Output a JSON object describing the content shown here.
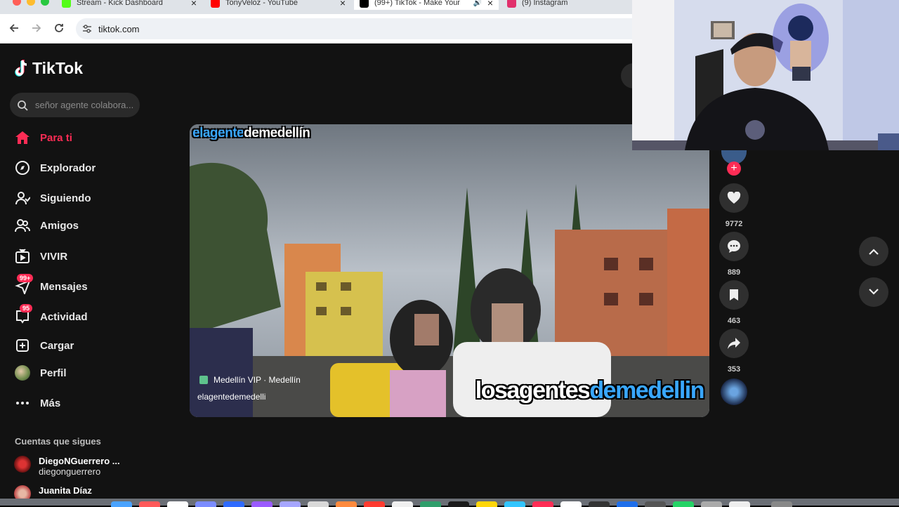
{
  "browser": {
    "tabs": [
      {
        "label": "Stream - Kick Dashboard",
        "icon": "kick-icon",
        "color": "#53fc18"
      },
      {
        "label": "TonyVeloz - YouTube",
        "icon": "youtube-icon",
        "color": "#ff0000"
      },
      {
        "label": "(99+) TikTok - Make Your",
        "icon": "tiktok-icon",
        "color": "#000000"
      },
      {
        "label": "(9) Instagram",
        "icon": "instagram-icon",
        "color": "#e1306c"
      }
    ],
    "url": "tiktok.com"
  },
  "sidebar": {
    "logo": "TikTok",
    "search_placeholder": "señor agente colabora...",
    "items": [
      {
        "label": "Para ti",
        "icon": "home-icon",
        "active": true
      },
      {
        "label": "Explorador",
        "icon": "compass-icon"
      },
      {
        "label": "Siguiendo",
        "icon": "following-icon"
      },
      {
        "label": "Amigos",
        "icon": "friends-icon"
      },
      {
        "label": "VIVIR",
        "icon": "live-icon"
      },
      {
        "label": "Mensajes",
        "icon": "messages-icon",
        "badge": "99+"
      },
      {
        "label": "Actividad",
        "icon": "activity-icon",
        "badge": "95"
      },
      {
        "label": "Cargar",
        "icon": "upload-icon"
      },
      {
        "label": "Perfil",
        "icon": "profile-avatar"
      },
      {
        "label": "Más",
        "icon": "more-icon"
      }
    ],
    "following_title": "Cuentas que sigues",
    "accounts": [
      {
        "name": "DiegoNGuerrero ...",
        "handle": "diegonguerrero"
      },
      {
        "name": "Juanita Díaz",
        "handle": ""
      }
    ]
  },
  "video": {
    "overlay_top_white": "elagente",
    "overlay_top_blue": "demedellín",
    "overlay_bottom_white": "losagentes",
    "overlay_bottom_blue": "demedellin",
    "location": "Medellín VIP · Medellín",
    "author": "elagentedemedelli"
  },
  "actions": {
    "likes": "9772",
    "comments": "889",
    "saves": "463",
    "shares": "353"
  },
  "colors": {
    "accent": "#fe2c55",
    "background": "#121212",
    "overlay_blue": "#39a7ff"
  }
}
